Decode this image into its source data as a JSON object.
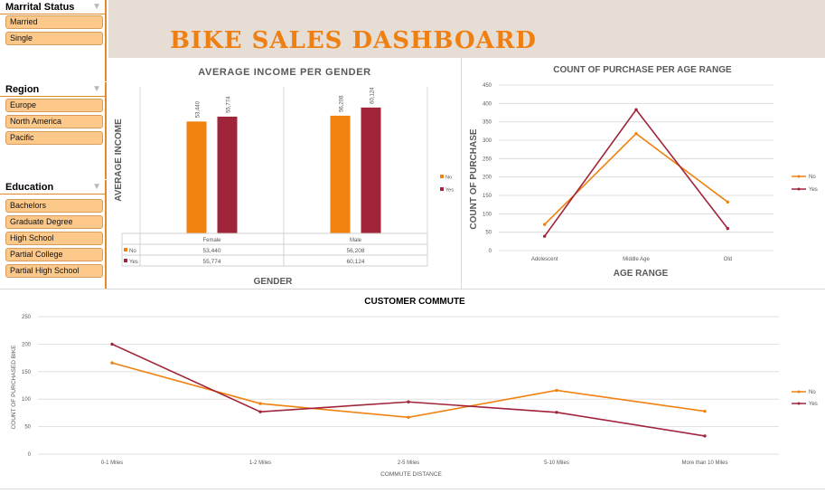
{
  "dashboard_title": "BIKE SALES DASHBOARD",
  "colors": {
    "no": "#f0820f",
    "yes": "#a0243a",
    "header_bg": "#e6ddd4",
    "slicer_item_bg": "#fcc98a",
    "accent": "#e08a2a"
  },
  "slicers": {
    "marital": {
      "title": "Marrital Status",
      "icon": "filter-clear-icon",
      "items": [
        "Married",
        "Single"
      ]
    },
    "region": {
      "title": "Region",
      "icon": "filter-clear-icon",
      "items": [
        "Europe",
        "North America",
        "Pacific"
      ]
    },
    "education": {
      "title": "Education",
      "icon": "filter-clear-icon",
      "items": [
        "Bachelors",
        "Graduate Degree",
        "High School",
        "Partial College",
        "Partial High School"
      ]
    }
  },
  "chart_data": [
    {
      "type": "bar",
      "title": "AVERAGE INCOME PER GENDER",
      "xlabel": "GENDER",
      "ylabel": "AVERAGE INCOME",
      "categories": [
        "Female",
        "Male"
      ],
      "series": [
        {
          "name": "No",
          "values": [
            53440,
            56208
          ],
          "labels": [
            "53,440",
            "56,208"
          ]
        },
        {
          "name": "Yes",
          "values": [
            55774,
            60124
          ],
          "labels": [
            "55,774",
            "60,124"
          ]
        }
      ],
      "ylim": [
        0,
        70000
      ],
      "legend": "right",
      "data_table": true
    },
    {
      "type": "line",
      "title": "COUNT OF PURCHASE PER AGE RANGE",
      "xlabel": "AGE RANGE",
      "ylabel": "COUNT OF PURCHASE",
      "categories": [
        "Adolescent",
        "Middle Age",
        "Old"
      ],
      "series": [
        {
          "name": "No",
          "values": [
            71,
            318,
            132
          ]
        },
        {
          "name": "Yes",
          "values": [
            39,
            383,
            60
          ]
        }
      ],
      "ylim": [
        0,
        450
      ],
      "yticks": [
        "0",
        "50",
        "100",
        "150",
        "200",
        "250",
        "300",
        "350",
        "400",
        "450"
      ],
      "legend": "right",
      "grid": true
    },
    {
      "type": "line",
      "title": "CUSTOMER COMMUTE",
      "xlabel": "COMMUTE DISTANCE",
      "ylabel": "COUNT OF PURCHASED BIKE",
      "categories": [
        "0-1 Miles",
        "1-2 Miles",
        "2-5 Miles",
        "5-10 Miles",
        "More than 10 Miles"
      ],
      "series": [
        {
          "name": "No",
          "values": [
            166,
            92,
            67,
            116,
            78
          ]
        },
        {
          "name": "Yes",
          "values": [
            200,
            77,
            95,
            76,
            33
          ]
        }
      ],
      "ylim": [
        0,
        250
      ],
      "yticks": [
        "0",
        "50",
        "100",
        "150",
        "200",
        "250"
      ],
      "legend": "right",
      "grid": true
    }
  ]
}
